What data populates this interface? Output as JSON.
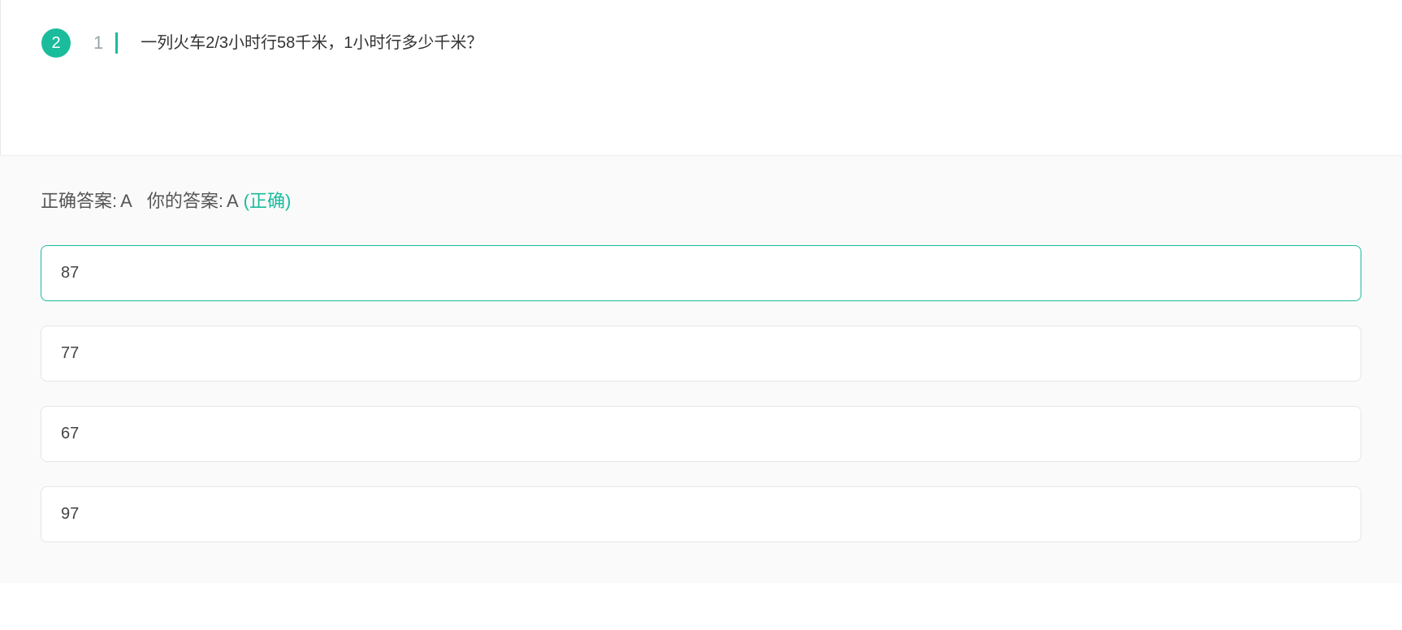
{
  "question": {
    "outer_number": "2",
    "inner_number": "1",
    "text": "一列火车2/3小时行58千米，1小时行多少千米？"
  },
  "answer_status": {
    "correct_label": "正确答案:",
    "correct_value": "A",
    "your_label": "你的答案:",
    "your_value": "A",
    "result_text": "(正确)"
  },
  "options": [
    {
      "text": "87",
      "selected": true
    },
    {
      "text": "77",
      "selected": false
    },
    {
      "text": "67",
      "selected": false
    },
    {
      "text": "97",
      "selected": false
    }
  ]
}
